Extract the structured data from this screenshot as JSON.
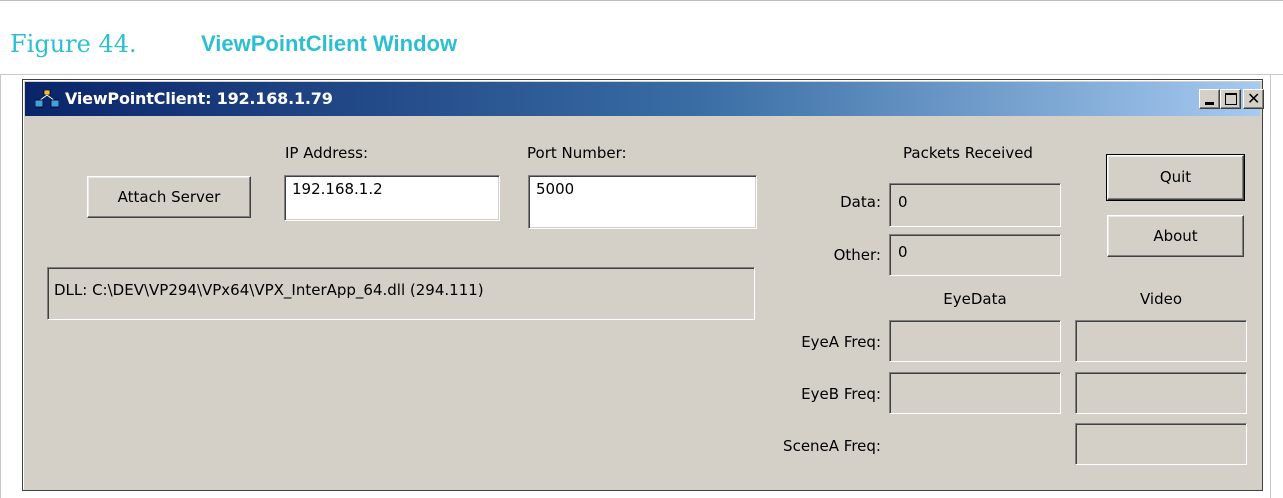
{
  "caption": {
    "number": "Figure 44.",
    "title": "ViewPointClient Window"
  },
  "window": {
    "title": "ViewPointClient: 192.168.1.79",
    "icon": "network-nodes-icon",
    "controls": [
      "minimize",
      "maximize",
      "close"
    ]
  },
  "connection": {
    "attach_label": "Attach Server",
    "ip_label": "IP Address:",
    "ip_value": "192.168.1.2",
    "port_label": "Port Number:",
    "port_value": "5000"
  },
  "dll_status": "DLL: C:\\DEV\\VP294\\VPx64\\VPX_InterApp_64.dll (294.111)",
  "packets": {
    "header": "Packets Received",
    "data_label": "Data:",
    "data_value": "0",
    "other_label": "Other:",
    "other_value": "0"
  },
  "actions": {
    "quit_label": "Quit",
    "about_label": "About"
  },
  "freq": {
    "eyedata_header": "EyeData",
    "video_header": "Video",
    "eyea_label": "EyeA Freq:",
    "eyeb_label": "EyeB Freq:",
    "scenea_label": "SceneA Freq:"
  },
  "colors": {
    "caption": "#2bbfd0",
    "dialog_face": "#d4d0c8",
    "titlebar_start": "#0a246a",
    "titlebar_end": "#a6caf0"
  }
}
